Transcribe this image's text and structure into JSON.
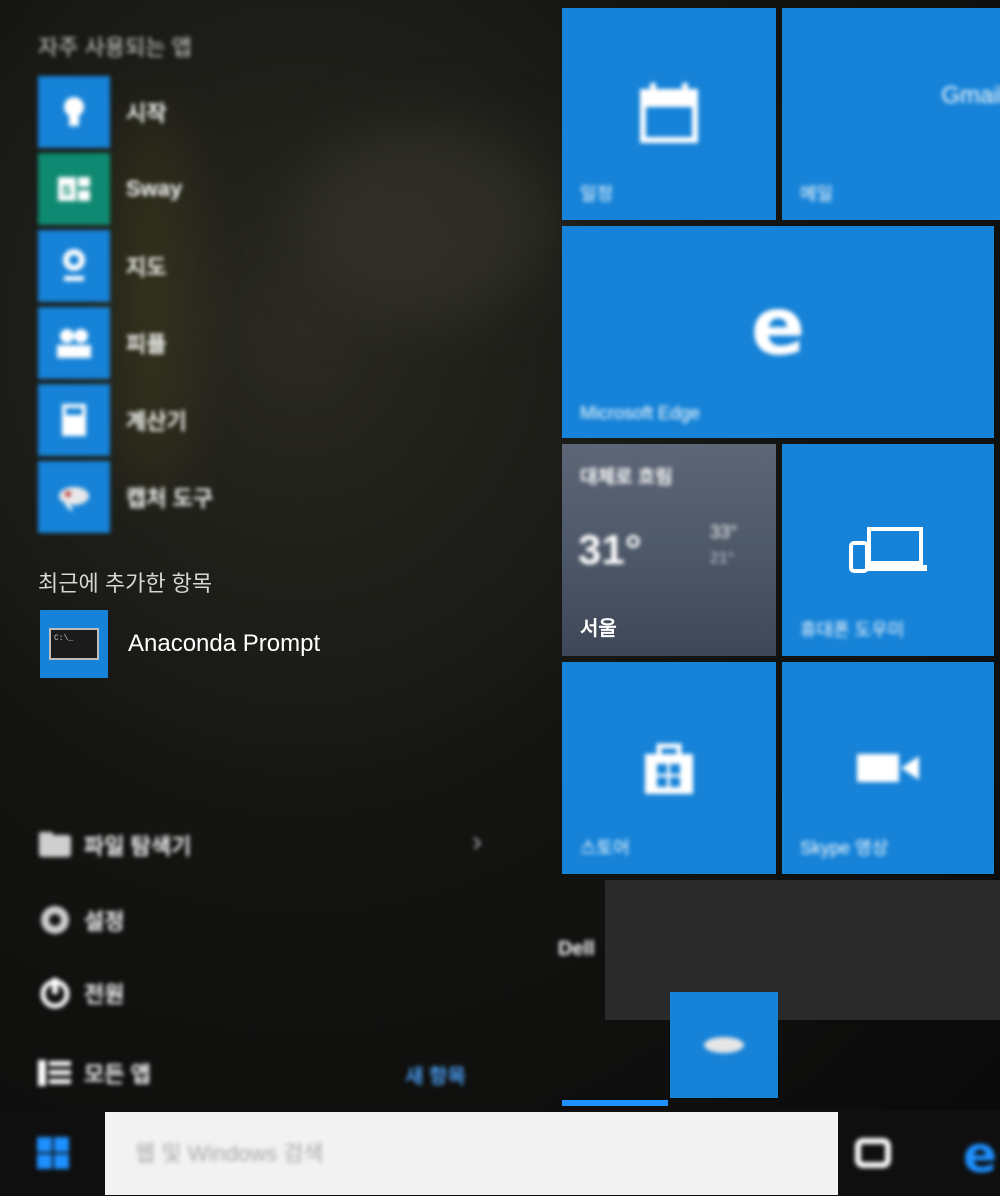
{
  "start_menu": {
    "most_used_title": "자주 사용되는 앱",
    "most_used": [
      {
        "label": "시작",
        "icon": "lightbulb-icon"
      },
      {
        "label": "Sway",
        "icon": "sway-icon"
      },
      {
        "label": "지도",
        "icon": "map-pin-icon"
      },
      {
        "label": "피플",
        "icon": "people-icon"
      },
      {
        "label": "계산기",
        "icon": "calculator-icon"
      },
      {
        "label": "캡처 도구",
        "icon": "snipping-tool-icon"
      }
    ],
    "recent_title": "최근에 추가한 항목",
    "recent": [
      {
        "label": "Anaconda Prompt",
        "icon": "terminal-icon"
      }
    ],
    "system": {
      "file_explorer": "파일 탐색기",
      "settings": "설정",
      "power": "전원",
      "all_apps": "모든 앱",
      "new_badge": "새 항목"
    }
  },
  "tiles": {
    "calendar": "일정",
    "mail": "메일",
    "mail_brand": "Gmail",
    "edge": "Microsoft Edge",
    "weather": {
      "condition": "대체로 흐림",
      "temp": "31°",
      "high": "33°",
      "low": "21°",
      "city": "서울"
    },
    "phone": "휴대폰 도우미",
    "store": "스토어",
    "skype": "Skype 영상",
    "group": "Dell"
  },
  "taskbar": {
    "search_placeholder": "웹 및 Windows 검색"
  },
  "colors": {
    "accent": "#1683d8",
    "background": "#0c0c0c"
  }
}
